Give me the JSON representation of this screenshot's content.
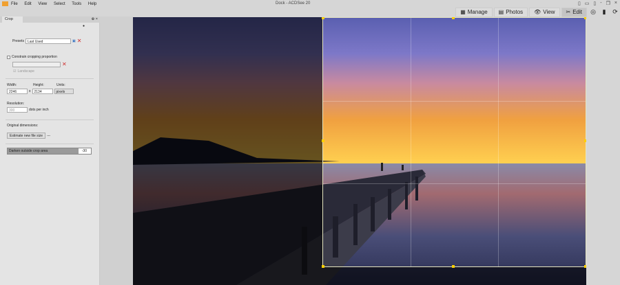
{
  "app": {
    "title": "Dock - ACDSee 20",
    "logo": "ACD"
  },
  "menu": [
    "File",
    "Edit",
    "View",
    "Select",
    "Tools",
    "Help"
  ],
  "modes": [
    {
      "label": "Manage",
      "icon": "grid-icon"
    },
    {
      "label": "Photos",
      "icon": "photos-icon"
    },
    {
      "label": "View",
      "icon": "eye-icon"
    },
    {
      "label": "Edit",
      "icon": "edit-icon",
      "active": true
    }
  ],
  "panel": {
    "tab": "Crop",
    "presets_label": "Presets",
    "presets_value": "Last Used",
    "constrain_label": "Constrain cropping proportion",
    "landscape_label": "Landscape",
    "width_label": "Width:",
    "width_value": "2246",
    "height_label": "Height:",
    "height_value": "2134",
    "units_label": "Units:",
    "units_value": "pixels",
    "x_sep": "x",
    "resolution_label": "Resolution:",
    "resolution_value": "300",
    "dpi_label": "dots per inch",
    "original_label": "Original dimensions:",
    "estimate_button": "Estimate new file size",
    "estimate_result": "---",
    "darken_label": "Darken outside crop area",
    "darken_value": "-30",
    "darken_fraction": 0.35
  }
}
